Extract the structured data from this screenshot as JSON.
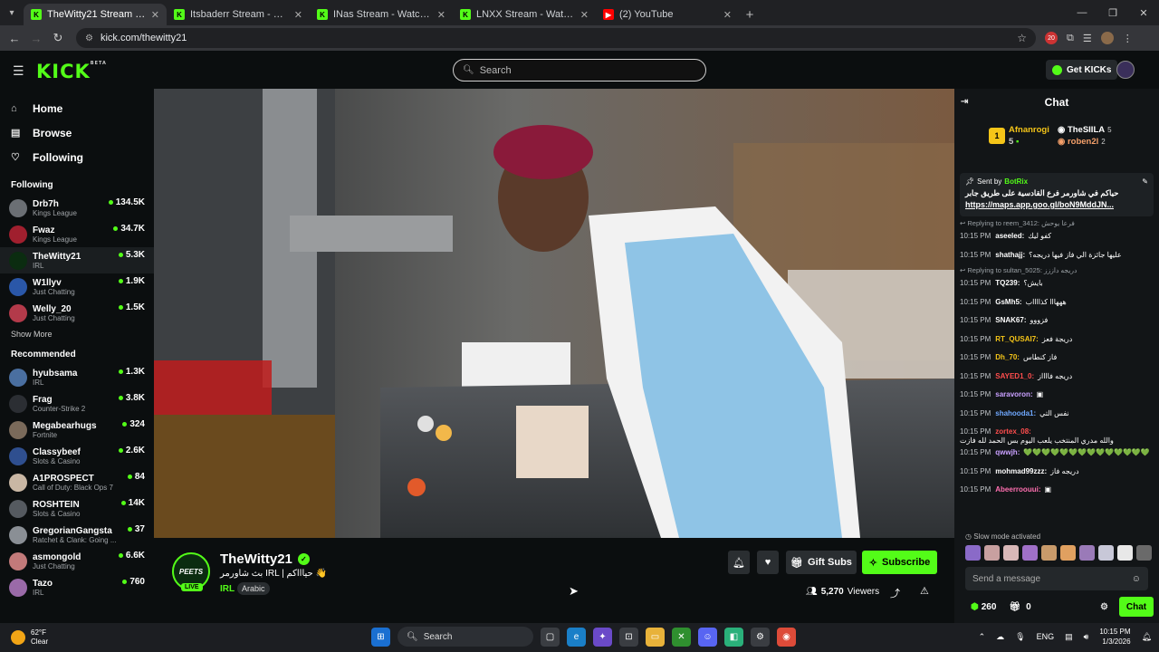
{
  "browser": {
    "tabs": [
      {
        "title": "TheWitty21 Stream - Watch",
        "fav": "K",
        "active": true
      },
      {
        "title": "Itsbaderr Stream - Watch Live o",
        "fav": "K",
        "active": false
      },
      {
        "title": "INas Stream - Watch Live on Ki",
        "fav": "K",
        "active": false
      },
      {
        "title": "LNXX Stream - Watch Live on K",
        "fav": "K",
        "active": false
      },
      {
        "title": "(2) YouTube",
        "fav": "▶",
        "active": false
      }
    ],
    "url": "kick.com/thewitty21",
    "ext_badge": "20"
  },
  "header": {
    "logo": "KICK",
    "logo_beta": "BETA",
    "search_placeholder": "Search",
    "get_kicks": "Get KICKs"
  },
  "sidebar": {
    "nav": [
      {
        "label": "Home",
        "icon": "home-icon"
      },
      {
        "label": "Browse",
        "icon": "browse-icon"
      },
      {
        "label": "Following",
        "icon": "heart-icon"
      }
    ],
    "following_title": "Following",
    "following": [
      {
        "name": "Drb7h",
        "category": "Kings League",
        "viewers": "134.5K",
        "color": "#6b6f74"
      },
      {
        "name": "Fwaz",
        "category": "Kings League",
        "viewers": "34.7K",
        "color": "#a01f2e"
      },
      {
        "name": "TheWitty21",
        "category": "IRL",
        "viewers": "5.3K",
        "color": "#0b2c10"
      },
      {
        "name": "W1llyv",
        "category": "Just Chatting",
        "viewers": "1.9K",
        "color": "#2a57a8"
      },
      {
        "name": "Welly_20",
        "category": "Just Chatting",
        "viewers": "1.5K",
        "color": "#b33a4a"
      }
    ],
    "show_more": "Show More",
    "recommended_title": "Recommended",
    "recommended": [
      {
        "name": "hyubsama",
        "category": "IRL",
        "viewers": "1.3K",
        "color": "#4a6fa0"
      },
      {
        "name": "Frag",
        "category": "Counter-Strike 2",
        "viewers": "3.8K",
        "color": "#2b2e33"
      },
      {
        "name": "Megabearhugs",
        "category": "Fortnite",
        "viewers": "324",
        "color": "#7a6a5a"
      },
      {
        "name": "Classybeef",
        "category": "Slots & Casino",
        "viewers": "2.6K",
        "color": "#2f4f8f"
      },
      {
        "name": "A1PROSPECT",
        "category": "Call of Duty: Black Ops 7",
        "viewers": "84",
        "color": "#c9b7a4"
      },
      {
        "name": "ROSHTEIN",
        "category": "Slots & Casino",
        "viewers": "14K",
        "color": "#555a60"
      },
      {
        "name": "GregorianGangsta",
        "category": "Ratchet & Clank: Going ...",
        "viewers": "37",
        "color": "#8a8f95"
      },
      {
        "name": "asmongold",
        "category": "Just Chatting",
        "viewers": "6.6K",
        "color": "#c27a7a"
      },
      {
        "name": "Tazo",
        "category": "IRL",
        "viewers": "760",
        "color": "#9a6aa8"
      }
    ]
  },
  "stream": {
    "channel": "TheWitty21",
    "avatar_text": "PEETS",
    "live": "LIVE",
    "title": "بث شاورمر IRL | حياااكم 👋",
    "category": "IRL",
    "tag": "Arabic",
    "gift_subs": "Gift Subs",
    "subscribe": "Subscribe",
    "viewers": "5,270",
    "viewers_label": "Viewers"
  },
  "chat": {
    "title": "Chat",
    "leaders": {
      "rank": "1",
      "first": {
        "name": "Afnanrogi",
        "count": "5"
      },
      "second": {
        "name": "TheSIILA",
        "count": "5"
      },
      "third": {
        "name": "roben2l",
        "count": "2"
      }
    },
    "pinned": {
      "sent_by": "Sent by",
      "bot": "BotRix",
      "message": "حياكم في شاورمر فرع القادسية على طريق جابر",
      "link": "https://maps.app.goo.gl/boN9MddJN..."
    },
    "messages": [
      {
        "reply": "Replying to reem_3412: فرعا يوحش",
        "time": "10:15 PM",
        "user": "aseeled",
        "color": "#ffffff",
        "text": "كفو ليك"
      },
      {
        "reply": "",
        "time": "10:15 PM",
        "user": "shathajj",
        "color": "#ffffff",
        "text": "عليها جائزة الي فاز فيها دريجه؟"
      },
      {
        "reply": "Replying to sultan_5025: دريجه داززز",
        "time": "10:15 PM",
        "user": "TQ239",
        "color": "#ffffff",
        "text": "بايش؟"
      },
      {
        "reply": "",
        "time": "10:15 PM",
        "user": "GsMh5",
        "color": "#ffffff",
        "text": "هههااا كذااااب"
      },
      {
        "reply": "",
        "time": "10:15 PM",
        "user": "SNAK67",
        "color": "#ffffff",
        "text": "فزووو"
      },
      {
        "reply": "",
        "time": "10:15 PM",
        "user": "RT_QUSAI7",
        "color": "#f5c518",
        "text": "دريجة فعز"
      },
      {
        "reply": "",
        "time": "10:15 PM",
        "user": "Dh_70",
        "color": "#f5c518",
        "text": "فاز كنطاس"
      },
      {
        "reply": "",
        "time": "10:15 PM",
        "user": "SAYED1_0",
        "color": "#ff4d4d",
        "text": "دريجه فااااز"
      },
      {
        "reply": "",
        "time": "10:15 PM",
        "user": "saravoron",
        "color": "#c9a0ff",
        "text": "▣"
      },
      {
        "reply": "",
        "time": "10:15 PM",
        "user": "shahooda1",
        "color": "#6fa8ff",
        "text": "نفس التي"
      },
      {
        "reply": "",
        "time": "10:15 PM",
        "user": "zortex_08",
        "color": "#ff4d4d",
        "text": "والله مدري المنتخب يلعب اليوم بس الحمد لله فازت"
      },
      {
        "reply": "",
        "time": "10:15 PM",
        "user": "qwwjh",
        "color": "#c9a0ff",
        "text": "💚💚💚💚💚💚💚💚💚💚💚💚💚💚"
      },
      {
        "reply": "",
        "time": "10:15 PM",
        "user": "mohmad99zzz",
        "color": "#ffffff",
        "text": "دريجه فاز"
      },
      {
        "reply": "",
        "time": "10:15 PM",
        "user": "Abeerroouui",
        "color": "#ff6fb0",
        "text": "▣"
      }
    ],
    "slow_mode": "Slow mode activated",
    "input_placeholder": "Send a message",
    "kicks": "260",
    "gifts": "0",
    "chat_button": "Chat"
  },
  "taskbar": {
    "temp": "62°F",
    "weather": "Clear",
    "search": "Search",
    "lang": "ENG",
    "time": "10:15 PM",
    "date": "1/3/2026"
  }
}
